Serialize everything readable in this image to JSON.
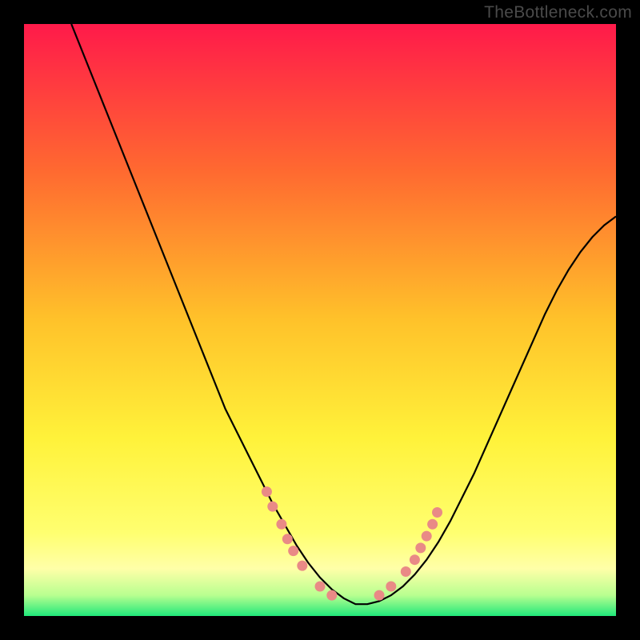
{
  "watermark": "TheBottleneck.com",
  "chart_data": {
    "type": "line",
    "title": "",
    "xlabel": "",
    "ylabel": "",
    "xlim": [
      0,
      100
    ],
    "ylim": [
      0,
      100
    ],
    "grid": false,
    "legend": false,
    "background_gradient": {
      "stops": [
        {
          "offset": 0.0,
          "color": "#ff1a4a"
        },
        {
          "offset": 0.25,
          "color": "#ff6a30"
        },
        {
          "offset": 0.5,
          "color": "#ffc22a"
        },
        {
          "offset": 0.7,
          "color": "#fff23a"
        },
        {
          "offset": 0.86,
          "color": "#ffff70"
        },
        {
          "offset": 0.92,
          "color": "#ffffa8"
        },
        {
          "offset": 0.965,
          "color": "#b8ff90"
        },
        {
          "offset": 1.0,
          "color": "#20e87a"
        }
      ]
    },
    "series": [
      {
        "name": "curve",
        "color": "#000000",
        "x": [
          8,
          10,
          12,
          14,
          16,
          18,
          20,
          22,
          24,
          26,
          28,
          30,
          32,
          34,
          36,
          38,
          40,
          42,
          44,
          46,
          48,
          50,
          52,
          54,
          56,
          58,
          60,
          62,
          64,
          66,
          68,
          70,
          72,
          74,
          76,
          78,
          80,
          82,
          84,
          86,
          88,
          90,
          92,
          94,
          96,
          98,
          100
        ],
        "y": [
          100,
          95,
          90,
          85,
          80,
          75,
          70,
          65,
          60,
          55,
          50,
          45,
          40,
          35,
          31,
          27,
          23,
          19,
          15.5,
          12,
          9,
          6.5,
          4.5,
          3,
          2,
          2,
          2.5,
          3.5,
          5,
          7,
          9.5,
          12.5,
          16,
          20,
          24,
          28.5,
          33,
          37.5,
          42,
          46.5,
          51,
          55,
          58.5,
          61.5,
          64,
          66,
          67.5
        ]
      }
    ],
    "dot_clusters": {
      "color": "#e98a86",
      "left": [
        [
          41,
          21
        ],
        [
          42,
          18.5
        ],
        [
          43.5,
          15.5
        ],
        [
          44.5,
          13
        ],
        [
          45.5,
          11
        ],
        [
          47,
          8.5
        ],
        [
          50,
          5
        ],
        [
          52,
          3.5
        ]
      ],
      "right": [
        [
          60,
          3.5
        ],
        [
          62,
          5
        ],
        [
          64.5,
          7.5
        ],
        [
          66,
          9.5
        ],
        [
          67,
          11.5
        ],
        [
          68,
          13.5
        ],
        [
          69,
          15.5
        ],
        [
          69.8,
          17.5
        ]
      ]
    }
  }
}
